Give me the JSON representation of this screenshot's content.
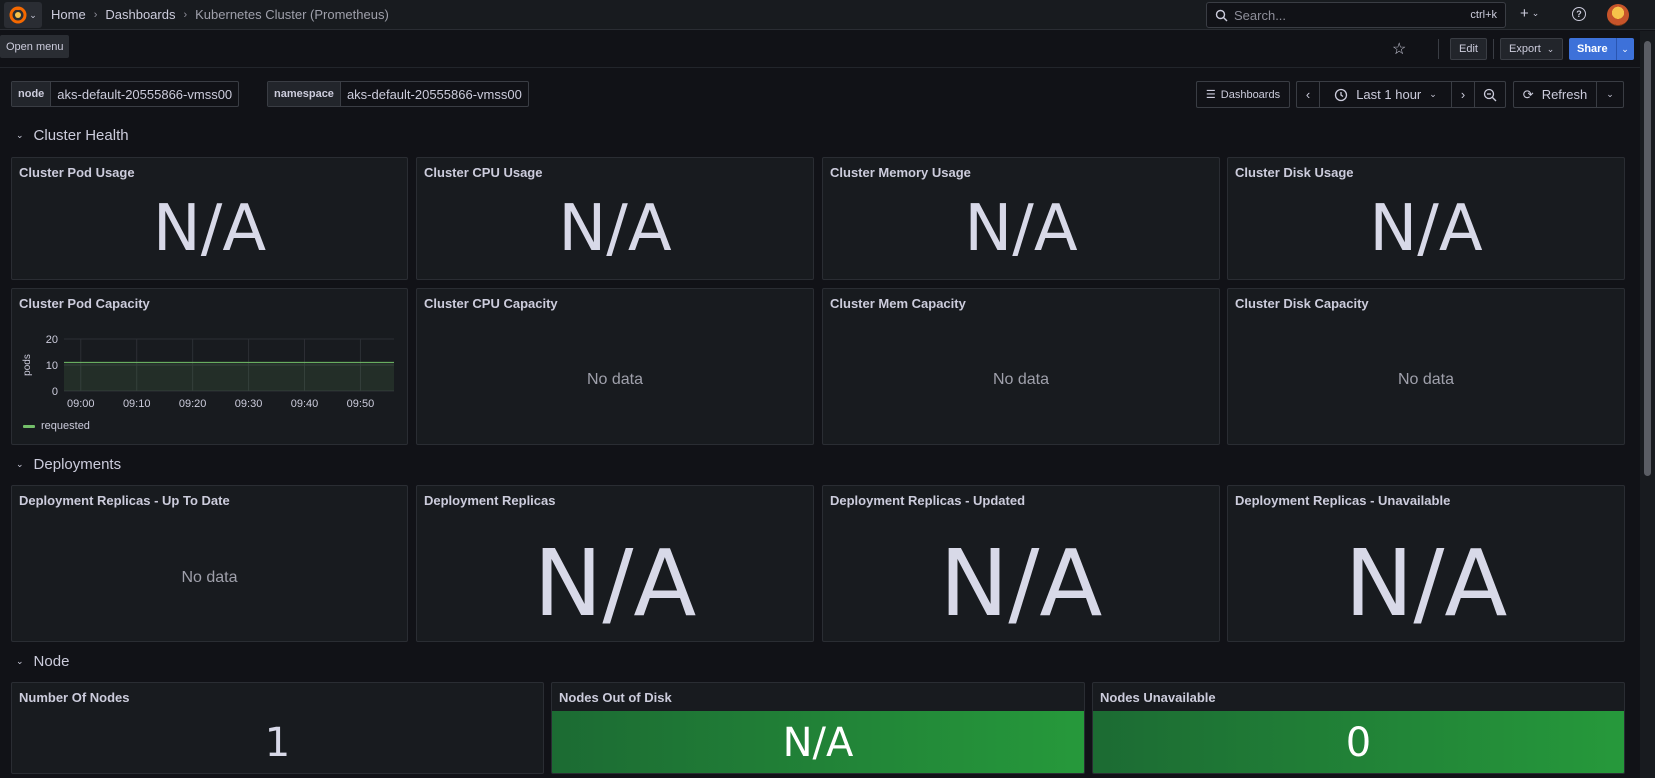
{
  "topbar": {
    "breadcrumbs": [
      "Home",
      "Dashboards",
      "Kubernetes Cluster (Prometheus)"
    ],
    "search_placeholder": "Search...",
    "search_shortcut": "ctrl+k",
    "tooltip": "Open menu"
  },
  "toolbar": {
    "edit_label": "Edit",
    "export_label": "Export",
    "share_label": "Share"
  },
  "variables": [
    {
      "label": "node",
      "value": "aks-default-20555866-vmss00"
    },
    {
      "label": "namespace",
      "value": "aks-default-20555866-vmss00"
    }
  ],
  "controls": {
    "dashboards_label": "Dashboards",
    "time_range": "Last 1 hour",
    "refresh_label": "Refresh"
  },
  "sections": {
    "cluster_health": "Cluster Health",
    "deployments": "Deployments",
    "node": "Node"
  },
  "panels": {
    "pod_usage": {
      "title": "Cluster Pod Usage",
      "value": "N/A"
    },
    "cpu_usage": {
      "title": "Cluster CPU Usage",
      "value": "N/A"
    },
    "mem_usage": {
      "title": "Cluster Memory Usage",
      "value": "N/A"
    },
    "disk_usage": {
      "title": "Cluster Disk Usage",
      "value": "N/A"
    },
    "pod_capacity": {
      "title": "Cluster Pod Capacity"
    },
    "cpu_capacity": {
      "title": "Cluster CPU Capacity",
      "value": "No data"
    },
    "mem_capacity": {
      "title": "Cluster Mem Capacity",
      "value": "No data"
    },
    "disk_capacity": {
      "title": "Cluster Disk Capacity",
      "value": "No data"
    },
    "dep_uptodate": {
      "title": "Deployment Replicas - Up To Date",
      "value": "No data"
    },
    "dep_replicas": {
      "title": "Deployment Replicas",
      "value": "N/A"
    },
    "dep_updated": {
      "title": "Deployment Replicas - Updated",
      "value": "N/A"
    },
    "dep_unavailable": {
      "title": "Deployment Replicas - Unavailable",
      "value": "N/A"
    },
    "num_nodes": {
      "title": "Number Of Nodes",
      "value": "1"
    },
    "nodes_out_disk": {
      "title": "Nodes Out of Disk",
      "value": "N/A"
    },
    "nodes_unavailable": {
      "title": "Nodes Unavailable",
      "value": "0"
    }
  },
  "colors": {
    "accent": "#3d71d9",
    "series": "#73bf69",
    "stat_green": "#26993b"
  },
  "chart_data": {
    "type": "line",
    "title": "Cluster Pod Capacity",
    "ylabel": "pods",
    "xlabel": "",
    "ylim": [
      0,
      20
    ],
    "yticks": [
      0,
      10,
      20
    ],
    "x_ticks": [
      "09:00",
      "09:10",
      "09:20",
      "09:30",
      "09:40",
      "09:50"
    ],
    "series": [
      {
        "name": "requested",
        "x": [
          "08:57",
          "09:00",
          "09:10",
          "09:20",
          "09:30",
          "09:40",
          "09:50",
          "09:56"
        ],
        "values": [
          11,
          11,
          11,
          11,
          11,
          11,
          11,
          11
        ]
      }
    ],
    "grid": true,
    "legend": "bottom-left"
  }
}
